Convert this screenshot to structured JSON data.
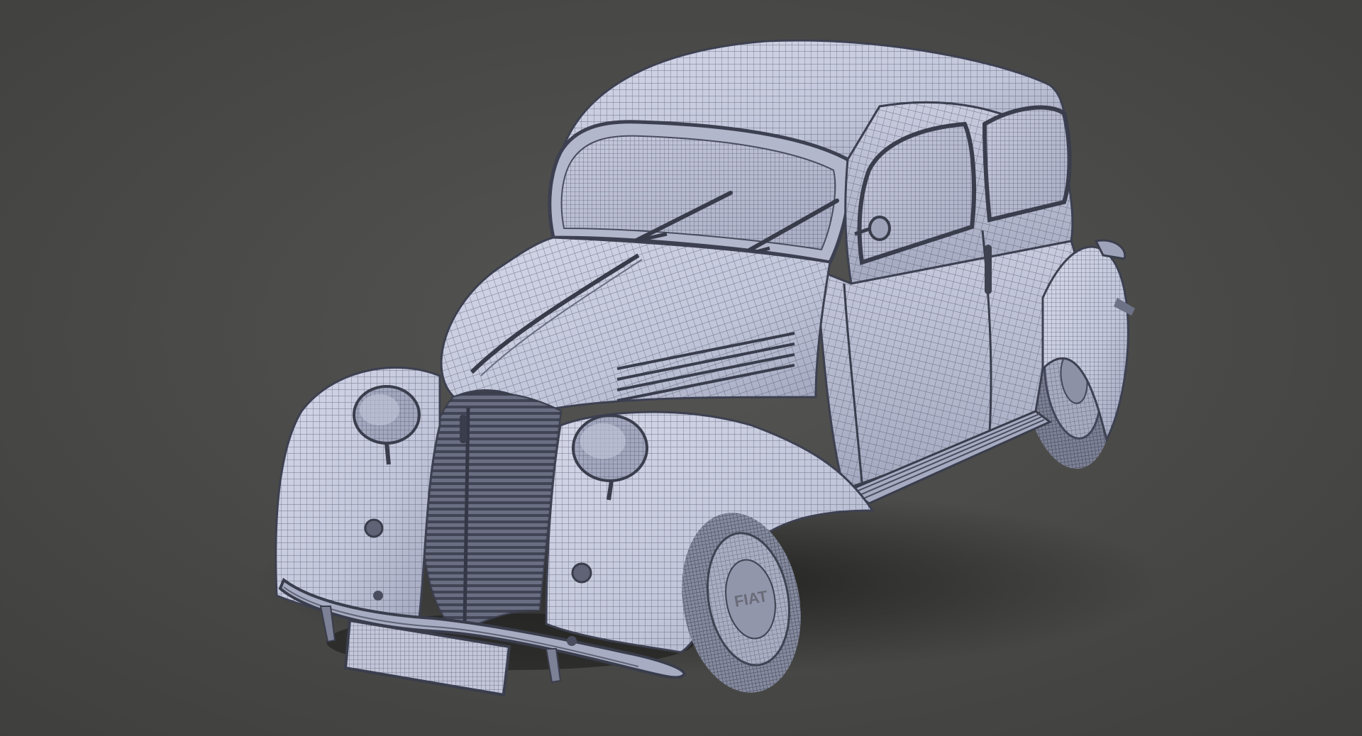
{
  "scene": {
    "subject": "vintage-sedan-wireframe-render",
    "hubcap_text": "FIAT",
    "colors": {
      "background": "#4a4a48",
      "body": "#c9ccdf",
      "body_shade": "#9da2ba",
      "wire": "#454858",
      "glass": "#b9bdd2",
      "tire": "#8e92a6"
    }
  }
}
